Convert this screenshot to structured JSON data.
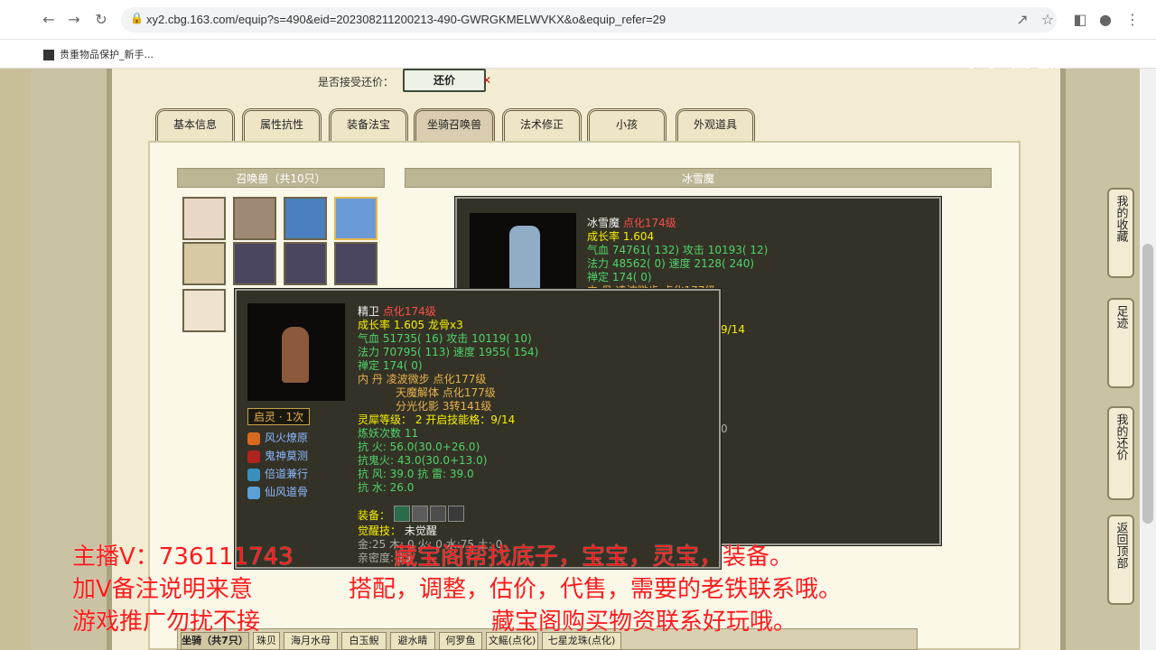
{
  "browser": {
    "url": "xy2.cbg.163.com/equip?s=490&eid=202308211200213-490-GWRGKMELWVKX&o&equip_refer=29",
    "bookmark": "贵重物品保护_新手...",
    "watermark": "CC直播"
  },
  "trade": {
    "accept_label": "是否接受还价：",
    "haggle_button": "还价",
    "reject_mark": "✕"
  },
  "tabs": [
    "基本信息",
    "属性抗性",
    "装备法宝",
    "坐骑召唤兽",
    "法术修正",
    "小孩",
    "外观道具"
  ],
  "pet_panel": {
    "title": "召唤兽（共10只）"
  },
  "detail_panel": {
    "title": "冰雪魔"
  },
  "pet1": {
    "name": "冰雪魔",
    "tag": "点化174级",
    "growth": "成长率 1.604",
    "hp": "气血 74761( 132)",
    "atk": "攻击 10193( 12)",
    "mp": "法力 48562( 0)",
    "spd": "速度 2128( 240)",
    "def": "禅定 174( 0)",
    "partial_a": "内 丹 凌波微步 点化177级",
    "partial_b": "9/14",
    "partial_c": "0"
  },
  "pet2": {
    "name": "精卫",
    "tag": "点化174级",
    "growth": "成长率 1.605 龙骨x3",
    "hp": "气血 51735( 16)",
    "atk": "攻击 10119( 10)",
    "mp": "法力 70795( 113)",
    "spd": "速度 1955( 154)",
    "def": "禅定 174( 0)",
    "neidan_label": "内 丹",
    "neidan1": "凌波微步 点化177级",
    "neidan2": "天魔解体 点化177级",
    "neidan3": "分光化影 3转141级",
    "lingsi_label": "灵犀等级：",
    "lingsi_value": "2 开启技能格：9/14",
    "lianyao": "炼妖次数 11",
    "kang_huo": "抗 火: 56.0(30.0+26.0)",
    "kang_guihuo": "抗鬼火: 43.0(30.0+13.0)",
    "kang_feng": "抗 风: 39.0",
    "kang_lei": "抗 雷: 39.0",
    "kang_shui": "抗 水: 26.0",
    "equip_label": "装备：",
    "awaken_label": "觉醒技：",
    "awaken_value": "未觉醒",
    "elements": "金:25 木: 0 火: 0 水:75 土: 0",
    "intimacy": "亲密度: 25",
    "qiling": "启灵 · 1次",
    "skills": [
      "风火燎原",
      "鬼神莫测",
      "倍道兼行",
      "仙风道骨"
    ]
  },
  "side_buttons": [
    "我的收藏",
    "足迹",
    "我的还价",
    "返回顶部"
  ],
  "overlay": {
    "line1a": "主播V：736111743",
    "line1b": "藏宝阁帮找底子，宝宝，灵宝，装备。",
    "line2a": "加V备注说明来意",
    "line2b": "搭配，调整，估价，代售，需要的老铁联系哦。",
    "line3a": "游戏推广勿扰不接",
    "line3b": "藏宝阁购买物资联系好玩哦。"
  },
  "bottom_tabs": [
    "坐骑（共7只）",
    "珠贝",
    "海月水母",
    "白玉鲵",
    "避水睛",
    "何罗鱼",
    "文鳐(点化)",
    "七星龙珠(点化)"
  ],
  "colors": {
    "overlay_red": "#ff1a1a",
    "tooltip_bg": "#343226",
    "page_bg": "#fbf8e8"
  }
}
